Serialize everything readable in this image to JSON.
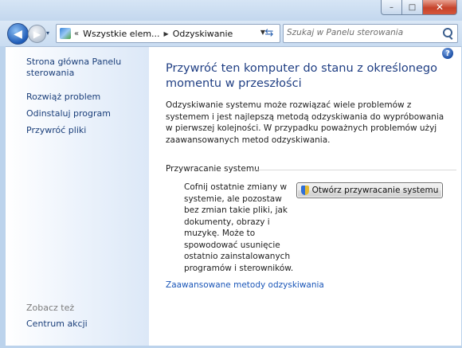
{
  "window": {
    "caption": {
      "minimize": "–",
      "maximize": "□",
      "close": "✕"
    }
  },
  "nav": {
    "back_glyph": "◀",
    "forward_glyph": "▶",
    "history_glyph": "▾",
    "breadcrumb_chevron": "«",
    "breadcrumbs": [
      "Wszystkie elem...",
      "Odzyskiwanie"
    ],
    "breadcrumb_separator": "▶",
    "dropdown_glyph": "▼",
    "refresh_glyph": "⇆",
    "search_placeholder": "Szukaj w Panelu sterowania"
  },
  "sidebar": {
    "home": "Strona główna Panelu sterowania",
    "items": [
      "Rozwiąż problem",
      "Odinstaluj program",
      "Przywróć pliki"
    ],
    "see_also_label": "Zobacz też",
    "see_also_items": [
      "Centrum akcji"
    ]
  },
  "help": {
    "glyph": "?"
  },
  "main": {
    "title": "Przywróć ten komputer do stanu z określonego momentu w przeszłości",
    "description": "Odzyskiwanie systemu może rozwiązać wiele problemów z systemem i jest najlepszą metodą odzyskiwania do wypróbowania w pierwszej kolejności. W przypadku poważnych problemów użyj zaawansowanych metod odzyskiwania.",
    "group_title": "Przywracanie systemu",
    "restore_text": "Cofnij ostatnie zmiany w systemie, ale pozostaw bez zmian takie pliki, jak dokumenty, obrazy i muzykę. Może to spowodować usunięcie ostatnio zainstalowanych programów i sterowników.",
    "restore_button": "Otwórz przywracanie systemu",
    "advanced_link": "Zaawansowane metody odzyskiwania"
  }
}
